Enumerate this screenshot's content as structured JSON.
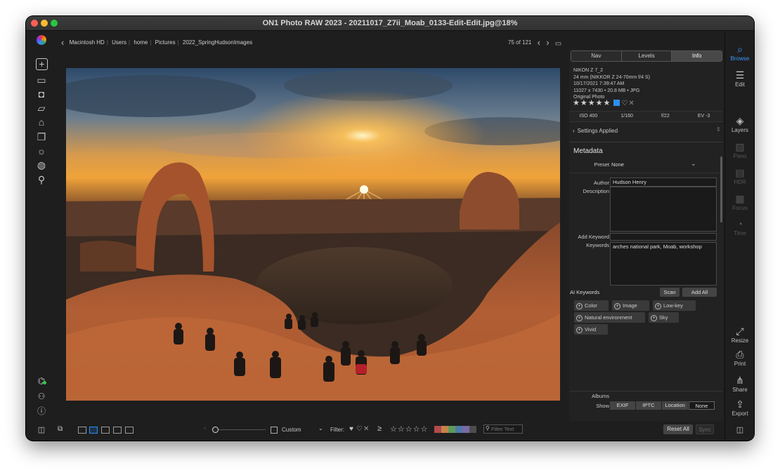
{
  "window": {
    "title": "ON1 Photo RAW 2023 - 20211017_Z7ii_Moab_0133-Edit-Edit.jpg@18%"
  },
  "breadcrumb": [
    "Macintosh HD",
    "Users",
    "home",
    "Pictures",
    "2022_SpringHudsonImages"
  ],
  "pager": {
    "position": "75 of 121"
  },
  "left_tools": [
    "add-icon",
    "monitor-icon",
    "camera-icon",
    "folder-cloud-icon",
    "drive-icon",
    "albums-icon",
    "light-icon",
    "sphere-icon",
    "search-icon"
  ],
  "left_bottom_tools": [
    "plugin-icon",
    "person-icon",
    "help-icon"
  ],
  "right_tools": [
    {
      "label": "Browse",
      "icon": "browse-icon",
      "state": "active"
    },
    {
      "label": "Edit",
      "icon": "sliders-icon",
      "state": "normal"
    },
    {
      "label": "Layers",
      "icon": "layers-icon",
      "state": "normal"
    },
    {
      "label": "Pano",
      "icon": "pano-icon",
      "state": "disabled"
    },
    {
      "label": "HDR",
      "icon": "hdr-icon",
      "state": "disabled"
    },
    {
      "label": "Focus",
      "icon": "focus-icon",
      "state": "disabled"
    },
    {
      "label": "Time",
      "icon": "time-icon",
      "state": "disabled"
    },
    {
      "label": "Resize",
      "icon": "resize-icon",
      "state": "normal"
    },
    {
      "label": "Print",
      "icon": "print-icon",
      "state": "normal"
    },
    {
      "label": "Share",
      "icon": "share-icon",
      "state": "normal"
    },
    {
      "label": "Export",
      "icon": "export-icon",
      "state": "normal"
    }
  ],
  "panel": {
    "tabs": [
      "Nav",
      "Levels",
      "Info"
    ],
    "active_tab": "Info",
    "info": {
      "camera": "NIKON Z 7_2",
      "lens": "24 mm (NIKKOR Z 24-70mm f/4 S)",
      "datetime": "10/17/2021 7:39:47 AM",
      "dims": "11027 x 7430  •  20.8 MB  •  JPG",
      "original": "Original Photo"
    },
    "rating": 5,
    "color_label": "#2c8ef0",
    "exif": [
      "ISO 400",
      "1/160",
      "f/22",
      "EV -3"
    ],
    "settings_applied": "Settings Applied",
    "metadata_title": "Metadata",
    "preset": {
      "label": "Preset",
      "value": "None"
    },
    "author": {
      "label": "Author",
      "value": "Hudson Henry"
    },
    "description": {
      "label": "Description",
      "value": ""
    },
    "add_keyword": {
      "label": "Add Keyword",
      "value": ""
    },
    "keywords": {
      "label": "Keywords",
      "value": "arches national park, Moab, workshop"
    },
    "ai_keywords": {
      "label": "AI Keywords",
      "scan": "Scan",
      "add_all": "Add All",
      "chips": [
        "Color",
        "Image",
        "Low-key",
        "Natural environment",
        "Sky",
        "Vivid"
      ]
    },
    "albums_label": "Albums",
    "show": {
      "label": "Show",
      "options": [
        "EXIF",
        "IPTC",
        "Location",
        "None"
      ],
      "selected": "None"
    }
  },
  "bottom": {
    "sort": "Custom",
    "filter_label": "Filter:",
    "gte": "≥",
    "filter_text_placeholder": "Filter Text",
    "reset_all": "Reset All",
    "sync": "Sync",
    "swatches": [
      "#b34b4b",
      "#c4844a",
      "#5e9b59",
      "#4f79a8",
      "#7a6aa3",
      "#4d4d4d"
    ]
  }
}
